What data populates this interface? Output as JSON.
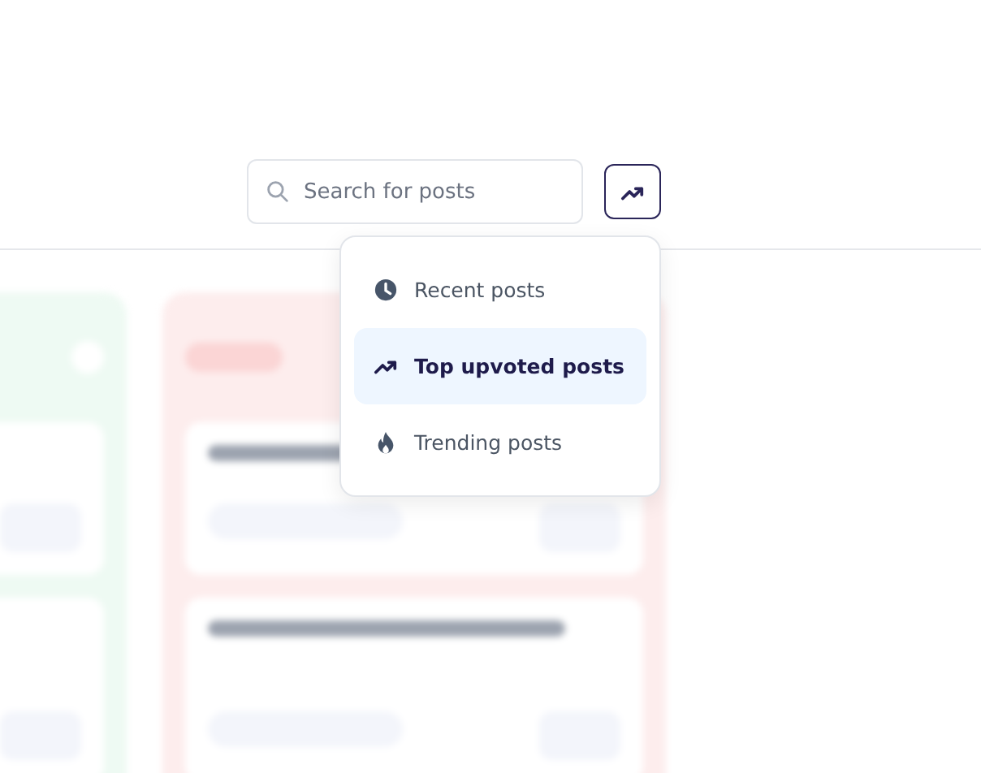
{
  "search": {
    "placeholder": "Search for posts"
  },
  "sort_button": {
    "active": true
  },
  "sort_menu": {
    "items": [
      {
        "label": "Recent posts",
        "kind": "clock",
        "selected": false
      },
      {
        "label": "Top upvoted posts",
        "kind": "trend",
        "selected": true
      },
      {
        "label": "Trending posts",
        "kind": "fire",
        "selected": false
      }
    ]
  }
}
